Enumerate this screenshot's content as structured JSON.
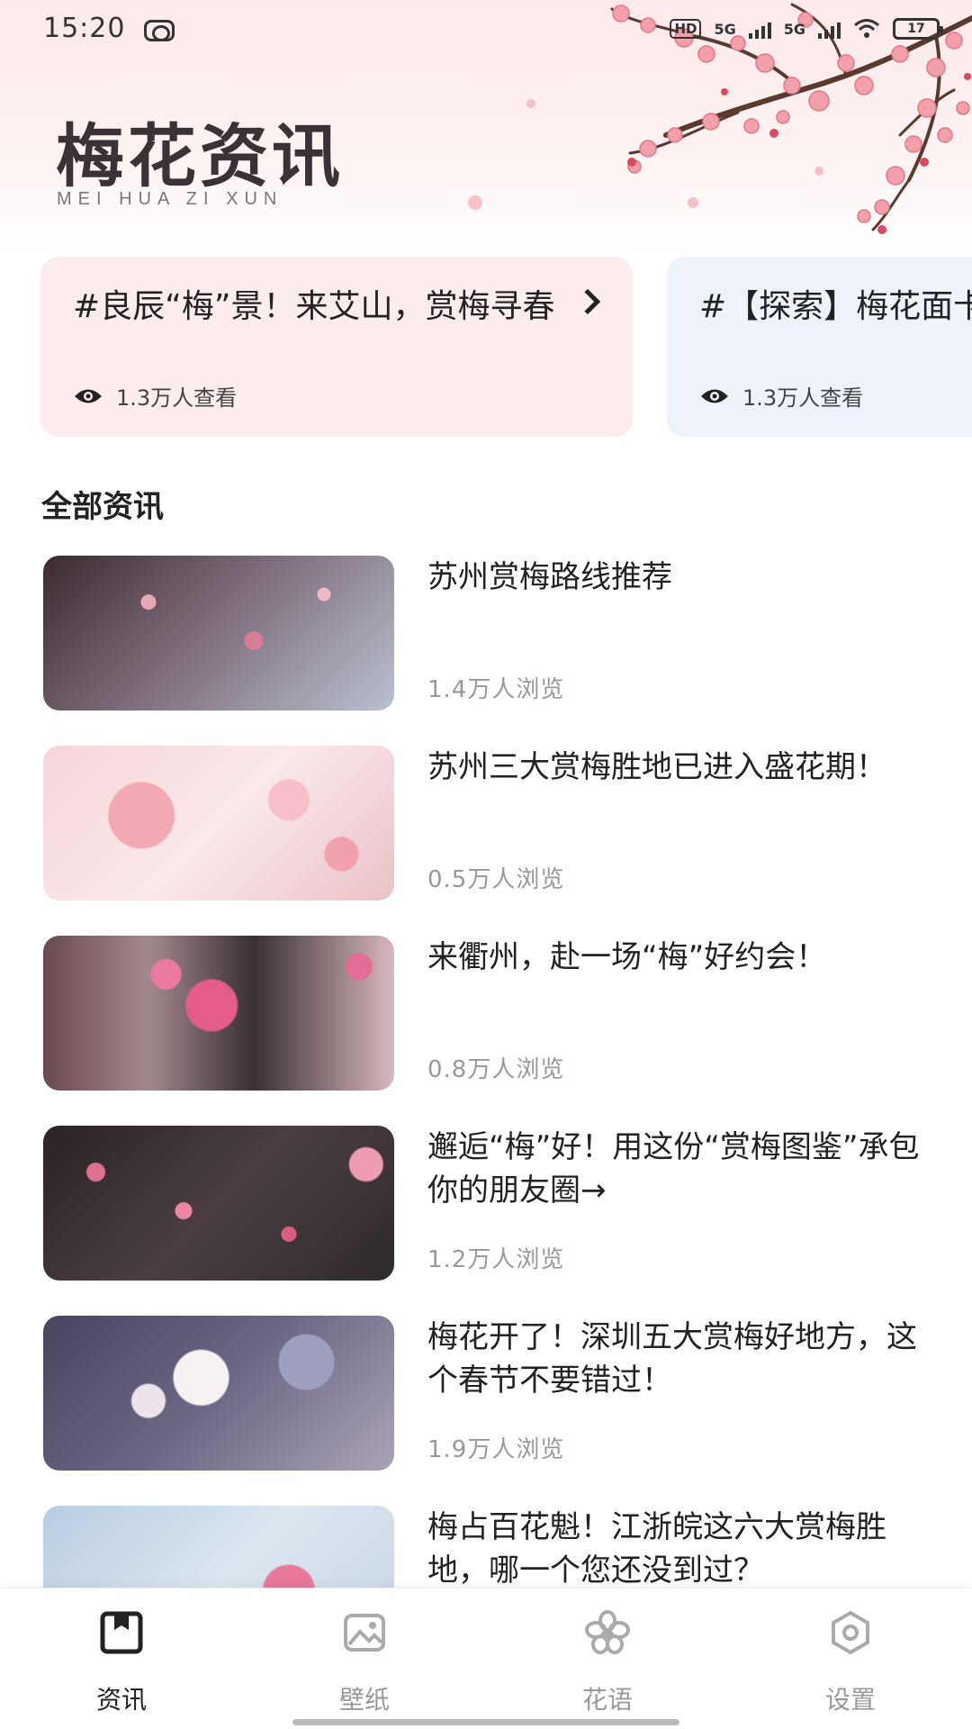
{
  "status_bar": {
    "time": "15:20",
    "network_1": "5G",
    "network_2": "5G",
    "hd_label": "HD",
    "battery": "17"
  },
  "header": {
    "title": "梅花资讯",
    "subtitle": "MEI HUA ZI XUN"
  },
  "topics": [
    {
      "title": "#良辰“梅”景！来艾山，赏梅寻春",
      "views": "1.3万人查看"
    },
    {
      "title": "#【探索】梅花面卡寻梅吧-",
      "views": "1.3万人查看"
    }
  ],
  "section": {
    "title": "全部资讯"
  },
  "news": [
    {
      "title": "苏州赏梅路线推荐",
      "views": "1.4万人浏览"
    },
    {
      "title": "苏州三大赏梅胜地已进入盛花期！",
      "views": "0.5万人浏览"
    },
    {
      "title": "来衢州，赴一场“梅”好约会！",
      "views": "0.8万人浏览"
    },
    {
      "title": "邂逅“梅”好！用这份“赏梅图鉴”承包你的朋友圈→",
      "views": "1.2万人浏览"
    },
    {
      "title": "梅花开了！深圳五大赏梅好地方，这个春节不要错过！",
      "views": "1.9万人浏览"
    },
    {
      "title": "梅占百花魁！江浙皖这六大赏梅胜地，哪一个您还没到过？",
      "views": ""
    }
  ],
  "tabbar": {
    "tabs": [
      {
        "label": "资讯",
        "icon": "news-icon",
        "active": true
      },
      {
        "label": "壁纸",
        "icon": "wallpaper-icon",
        "active": false
      },
      {
        "label": "花语",
        "icon": "flower-icon",
        "active": false
      },
      {
        "label": "设置",
        "icon": "settings-icon",
        "active": false
      }
    ]
  },
  "colors": {
    "accent_pink": "#fdeced",
    "accent_blue": "#edf2fb",
    "blossom": "#f08a98",
    "branch": "#5a3a2e",
    "active_text": "#222222",
    "inactive_text": "#999999"
  }
}
